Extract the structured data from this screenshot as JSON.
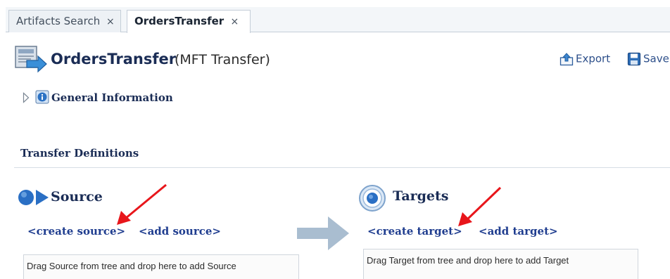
{
  "tabs": [
    {
      "label": "Artifacts Search",
      "close": "×",
      "active": false
    },
    {
      "label": "OrdersTransfer",
      "close": "×",
      "active": true
    }
  ],
  "header": {
    "title": "OrdersTransfer",
    "subtitle": "(MFT Transfer)",
    "page_icon": "transfer-document-icon"
  },
  "toolbar": {
    "export_label": "Export",
    "export_icon": "export-icon",
    "save_label": "Save",
    "save_icon": "save-icon"
  },
  "general_information": {
    "label": "General Information",
    "expanded": false,
    "icon": "info-icon"
  },
  "transfer_definitions": {
    "label": "Transfer Definitions",
    "source": {
      "title": "Source",
      "create_link": "<create source>",
      "add_link": "<add source>",
      "drop_hint": "Drag Source from tree and drop here to add Source"
    },
    "targets": {
      "title": "Targets",
      "create_link": "<create target>",
      "add_link": "<add target>",
      "drop_hint": "Drag Target from tree and drop here to add Target"
    }
  },
  "colors": {
    "title": "#1a2c55",
    "link": "#1f3d8f",
    "annotation_arrow": "#e8161b",
    "flow_arrow": "#a9bdd0"
  }
}
